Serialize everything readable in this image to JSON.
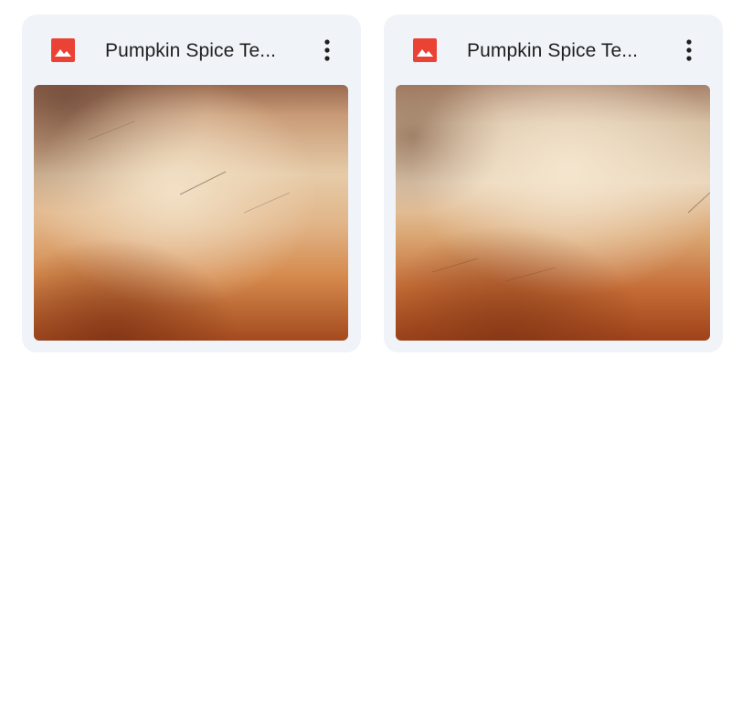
{
  "files": [
    {
      "name": "Pumpkin Spice Te...",
      "type_icon": "image-file-icon",
      "menu_icon": "more-vert-icon"
    },
    {
      "name": "Pumpkin Spice Te...",
      "type_icon": "image-file-icon",
      "menu_icon": "more-vert-icon"
    }
  ],
  "colors": {
    "card_bg": "#f0f3f8",
    "icon_red": "#ea4335",
    "title_text": "#1f1f1f",
    "texture_light": "#e9d2b3",
    "texture_mid": "#d59a63",
    "texture_dark": "#a24a1c"
  }
}
